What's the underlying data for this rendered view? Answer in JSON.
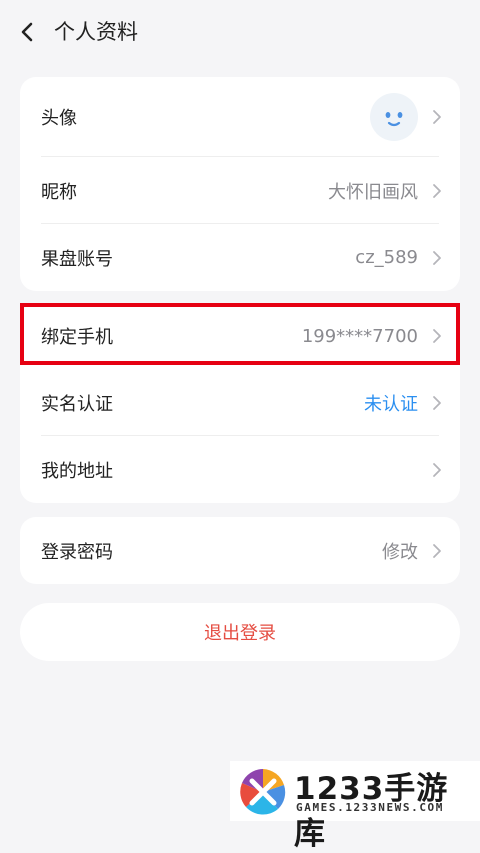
{
  "header": {
    "title": "个人资料"
  },
  "card1": {
    "avatar_label": "头像",
    "nickname_label": "昵称",
    "nickname_value": "大怀旧画风",
    "account_label": "果盘账号",
    "account_value": "cz_589"
  },
  "card2": {
    "phone_label": "绑定手机",
    "phone_value": "199****7700",
    "realname_label": "实名认证",
    "realname_value": "未认证",
    "address_label": "我的地址"
  },
  "card3": {
    "password_label": "登录密码",
    "password_value": "修改"
  },
  "logout": {
    "label": "退出登录"
  },
  "watermark": {
    "brand": "1233手游库",
    "site": "GAMES.1233NEWS.COM"
  },
  "colors": {
    "highlight": "#e60012",
    "link": "#2b8ff0",
    "logout": "#e54d42"
  }
}
